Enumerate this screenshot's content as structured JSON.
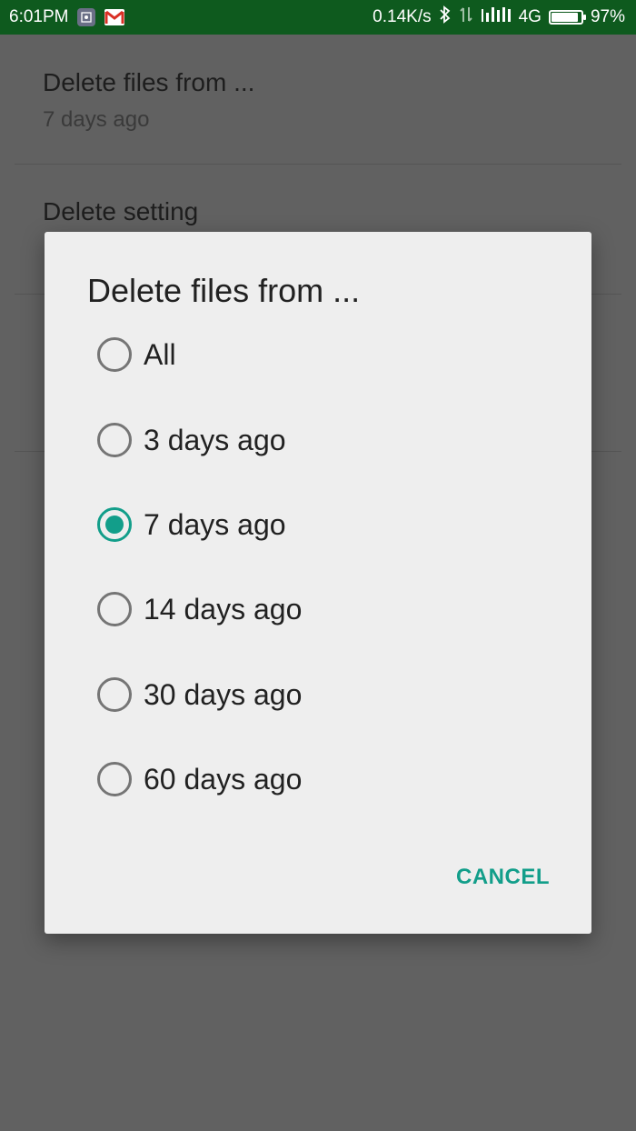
{
  "status_bar": {
    "time": "6:01PM",
    "network_speed": "0.14K/s",
    "network_type": "4G",
    "battery_percent": "97%",
    "battery_level": 0.97
  },
  "background": {
    "items": [
      {
        "title": "Delete files from ...",
        "subtitle": "7 days ago"
      },
      {
        "title": "Delete setting",
        "subtitle": ""
      }
    ]
  },
  "dialog": {
    "title": "Delete files from ...",
    "options": [
      {
        "label": "All",
        "checked": false
      },
      {
        "label": "3 days ago",
        "checked": false
      },
      {
        "label": "7 days ago",
        "checked": true
      },
      {
        "label": "14 days ago",
        "checked": false
      },
      {
        "label": "30 days ago",
        "checked": false
      },
      {
        "label": "60 days ago",
        "checked": false
      }
    ],
    "cancel_label": "CANCEL"
  },
  "colors": {
    "status_bar": "#0e5a1e",
    "accent": "#129e8a",
    "scrim": "#616161",
    "dialog_bg": "#eeeeee"
  },
  "icons": [
    "screenshot-app-icon",
    "gmail-icon",
    "bluetooth-icon",
    "data-transfer-icon",
    "signal-icon",
    "battery-icon"
  ]
}
